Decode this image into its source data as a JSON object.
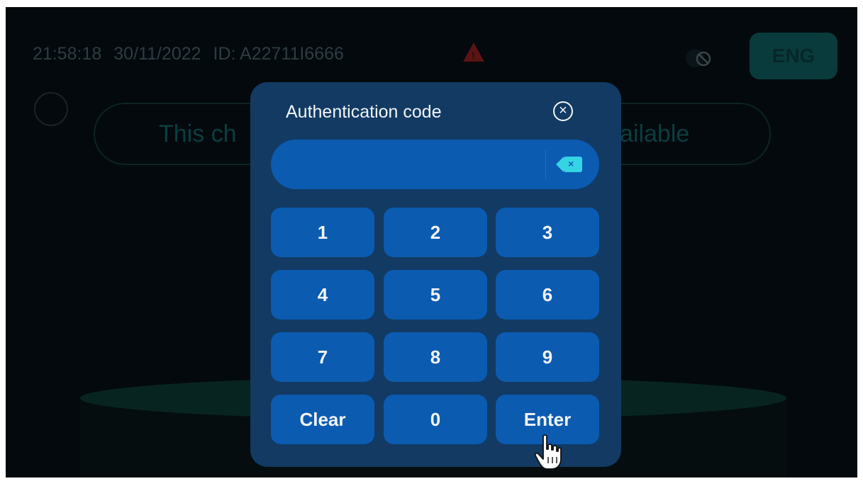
{
  "status": {
    "time": "21:58:18",
    "date": "30/11/2022",
    "device_id": "ID: A22711I6666",
    "warning_icon": "warning-triangle-icon",
    "network_icon": "no-signal-icon"
  },
  "language_button": "ENG",
  "banner": {
    "text_left": "This ch",
    "text_right": "ailable"
  },
  "dialog": {
    "title": "Authentication code",
    "close_icon": "close-circle-icon",
    "code_value": "",
    "backspace_icon": "backspace-icon",
    "keys": [
      "1",
      "2",
      "3",
      "4",
      "5",
      "6",
      "7",
      "8",
      "9",
      "Clear",
      "0",
      "Enter"
    ]
  },
  "colors": {
    "dialog_bg": "#123a63",
    "key_bg": "#0b5bb0",
    "accent_cyan": "#34d4e4",
    "warning_red": "#5a1414"
  }
}
